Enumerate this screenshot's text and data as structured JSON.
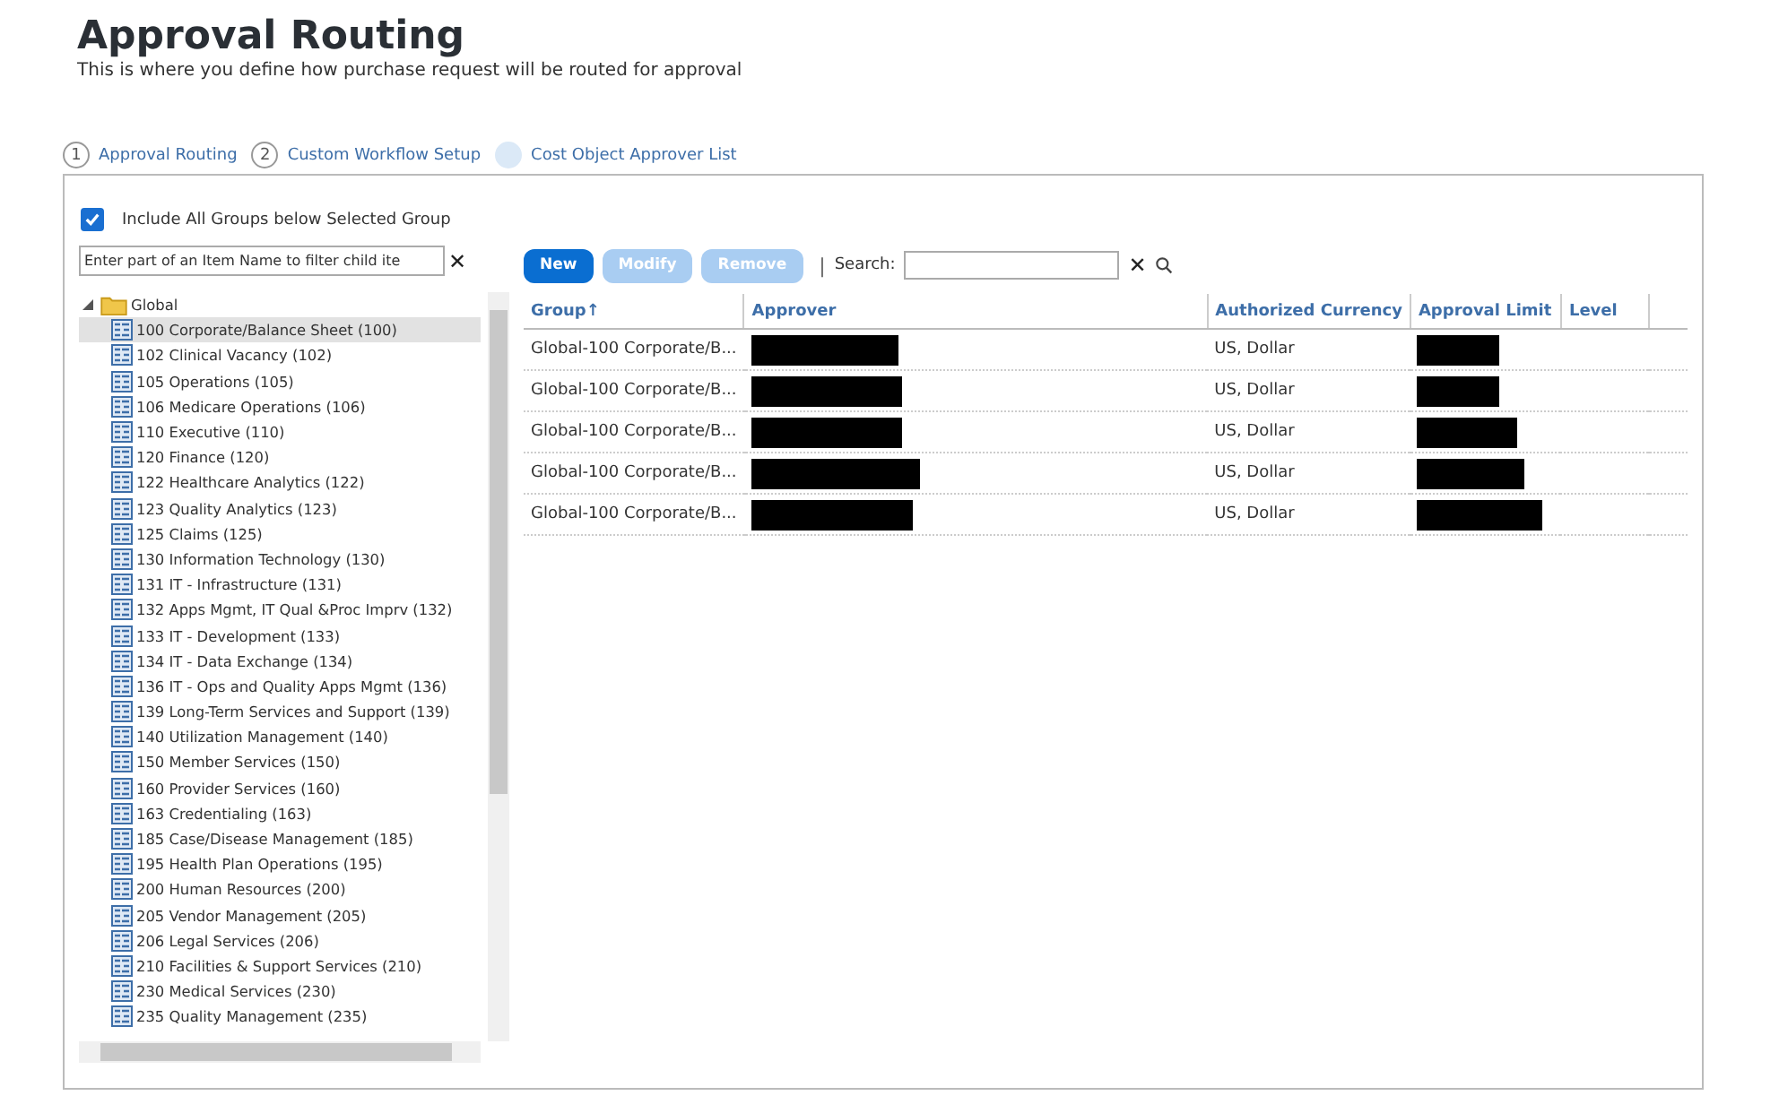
{
  "page": {
    "title": "Approval Routing",
    "subtitle": "This is where you define how purchase request will be routed for approval"
  },
  "steps": [
    {
      "number": "1",
      "label": "Approval Routing",
      "selected": false
    },
    {
      "number": "2",
      "label": "Custom Workflow Setup",
      "selected": false
    },
    {
      "label": "Cost Object Approver List",
      "selected": true
    }
  ],
  "include_all_groups": {
    "label": "Include All Groups below Selected Group",
    "checked": true
  },
  "tree_filter": {
    "placeholder": "Enter part of an Item Name to filter child ite",
    "clear": "✕"
  },
  "tree": {
    "label": "Global",
    "expanded": true,
    "children": [
      {
        "label": "100 Corporate/Balance Sheet (100)",
        "selected": true
      },
      {
        "label": "102 Clinical Vacancy (102)",
        "selected": false
      },
      {
        "label": "105 Operations (105)",
        "selected": false
      },
      {
        "label": "106 Medicare Operations (106)",
        "selected": false
      },
      {
        "label": "110 Executive (110)",
        "selected": false
      },
      {
        "label": "120 Finance (120)",
        "selected": false
      },
      {
        "label": "122 Healthcare Analytics (122)",
        "selected": false
      },
      {
        "label": "123 Quality Analytics (123)",
        "selected": false
      },
      {
        "label": "125 Claims (125)",
        "selected": false
      },
      {
        "label": "130 Information Technology (130)",
        "selected": false
      },
      {
        "label": "131 IT - Infrastructure (131)",
        "selected": false
      },
      {
        "label": "132 Apps Mgmt, IT Qual &Proc Imprv (132)",
        "selected": false
      },
      {
        "label": "133 IT - Development (133)",
        "selected": false
      },
      {
        "label": "134 IT - Data Exchange (134)",
        "selected": false
      },
      {
        "label": "136 IT - Ops and Quality Apps Mgmt (136)",
        "selected": false
      },
      {
        "label": "139 Long-Term Services and Support (139)",
        "selected": false
      },
      {
        "label": "140 Utilization Management (140)",
        "selected": false
      },
      {
        "label": "150 Member Services (150)",
        "selected": false
      },
      {
        "label": "160 Provider Services (160)",
        "selected": false
      },
      {
        "label": "163 Credentialing (163)",
        "selected": false
      },
      {
        "label": "185 Case/Disease Management (185)",
        "selected": false
      },
      {
        "label": "195 Health Plan Operations (195)",
        "selected": false
      },
      {
        "label": "200 Human Resources (200)",
        "selected": false
      },
      {
        "label": "205 Vendor Management (205)",
        "selected": false
      },
      {
        "label": "206 Legal Services (206)",
        "selected": false
      },
      {
        "label": "210 Facilities & Support Services (210)",
        "selected": false
      },
      {
        "label": "230 Medical Services (230)",
        "selected": false
      },
      {
        "label": "235 Quality Management (235)",
        "selected": false
      }
    ]
  },
  "toolbar": {
    "buttons": [
      {
        "label": "New",
        "disabled": false
      },
      {
        "label": "Modify",
        "disabled": true
      },
      {
        "label": "Remove",
        "disabled": true
      }
    ],
    "separator": "|",
    "search_label": "Search:",
    "clear": "✕"
  },
  "table": {
    "columns": [
      "Group↑",
      "Approver",
      "Authorized Currency",
      "Approval Limit",
      "Level"
    ],
    "rows": [
      {
        "group": "Global-100 Corporate/B...",
        "currency": "US, Dollar"
      },
      {
        "group": "Global-100 Corporate/B...",
        "currency": "US, Dollar"
      },
      {
        "group": "Global-100 Corporate/B...",
        "currency": "US, Dollar"
      },
      {
        "group": "Global-100 Corporate/B...",
        "currency": "US, Dollar"
      },
      {
        "group": "Global-100 Corporate/B...",
        "currency": "US, Dollar"
      }
    ]
  }
}
